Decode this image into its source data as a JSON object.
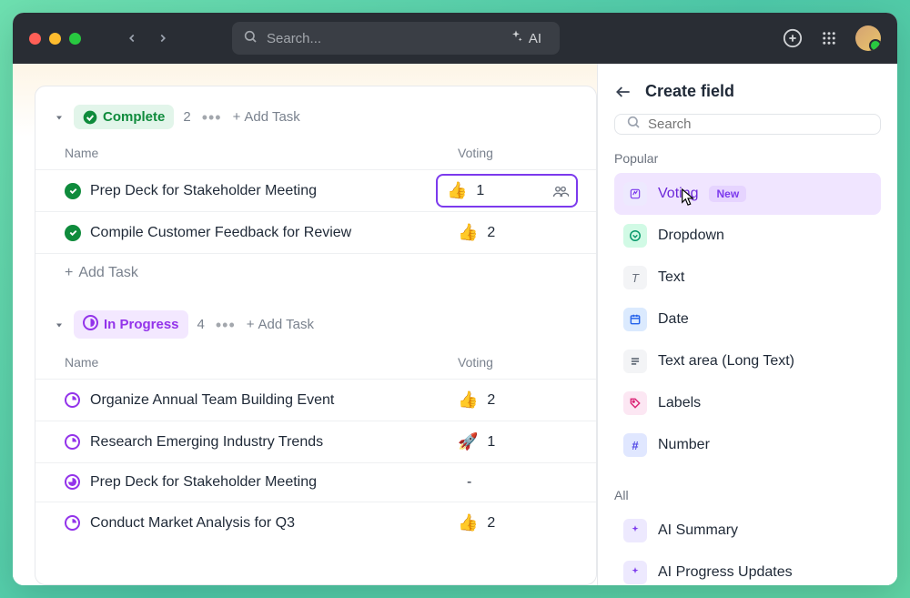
{
  "titlebar": {
    "search_placeholder": "Search...",
    "ai_label": "AI"
  },
  "groups": [
    {
      "status": "Complete",
      "count": "2",
      "add_label": "Add Task",
      "columns": {
        "name": "Name",
        "voting": "Voting"
      },
      "rows": [
        {
          "icon": "check",
          "name": "Prep Deck for Stakeholder Meeting",
          "vote_emoji": "👍",
          "vote_count": "1",
          "selected": true
        },
        {
          "icon": "check",
          "name": "Compile Customer Feedback for Review",
          "vote_emoji": "👍",
          "vote_count": "2"
        }
      ],
      "footer_add": "Add Task"
    },
    {
      "status": "In Progress",
      "count": "4",
      "add_label": "Add Task",
      "columns": {
        "name": "Name",
        "voting": "Voting"
      },
      "rows": [
        {
          "icon": "prog-q",
          "name": "Organize Annual Team Building Event",
          "vote_emoji": "👍",
          "vote_count": "2"
        },
        {
          "icon": "prog-q",
          "name": "Research Emerging Industry Trends",
          "vote_emoji": "🚀",
          "vote_count": "1"
        },
        {
          "icon": "prog-f",
          "name": "Prep Deck for Stakeholder Meeting",
          "vote_emoji": "",
          "vote_count": "-"
        },
        {
          "icon": "prog-q",
          "name": "Conduct Market Analysis for Q3",
          "vote_emoji": "👍",
          "vote_count": "2"
        }
      ]
    }
  ],
  "sidepanel": {
    "title": "Create field",
    "search_placeholder": "Search",
    "section_popular": "Popular",
    "section_all": "All",
    "popular": [
      {
        "key": "voting",
        "label": "Voting",
        "badge": "New",
        "selected": true
      },
      {
        "key": "dropdown",
        "label": "Dropdown"
      },
      {
        "key": "text",
        "label": "Text"
      },
      {
        "key": "date",
        "label": "Date"
      },
      {
        "key": "textarea",
        "label": "Text area (Long Text)"
      },
      {
        "key": "labels",
        "label": "Labels"
      },
      {
        "key": "number",
        "label": "Number"
      }
    ],
    "all": [
      {
        "key": "ai",
        "label": "AI Summary"
      },
      {
        "key": "ai",
        "label": "AI Progress Updates"
      }
    ]
  }
}
